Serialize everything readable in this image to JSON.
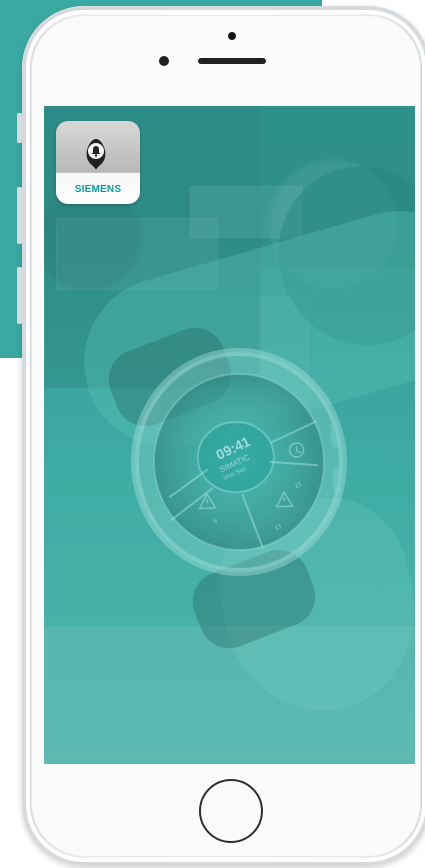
{
  "app": {
    "brand": "SIEMENS",
    "icon_name": "siemens-alarm-bell-app-icon"
  },
  "watch": {
    "time": "09:41",
    "title": "SIMATIC",
    "date": "Mon Sep",
    "counts": {
      "right": "23",
      "bottom": "13",
      "left": "5"
    }
  },
  "colors": {
    "teal": "#3aa9a3",
    "siemens_teal": "#0f9a9f",
    "phone_white": "#fbfbfc",
    "screen_teal": "#3ea8a1"
  },
  "icons": {
    "earpiece": "earpiece-icon",
    "camera": "front-camera-icon",
    "sensor": "sensor-dot-icon",
    "home": "home-button-icon",
    "bell": "bell-icon",
    "alert": "alert-triangle-icon",
    "clock": "clock-icon"
  }
}
